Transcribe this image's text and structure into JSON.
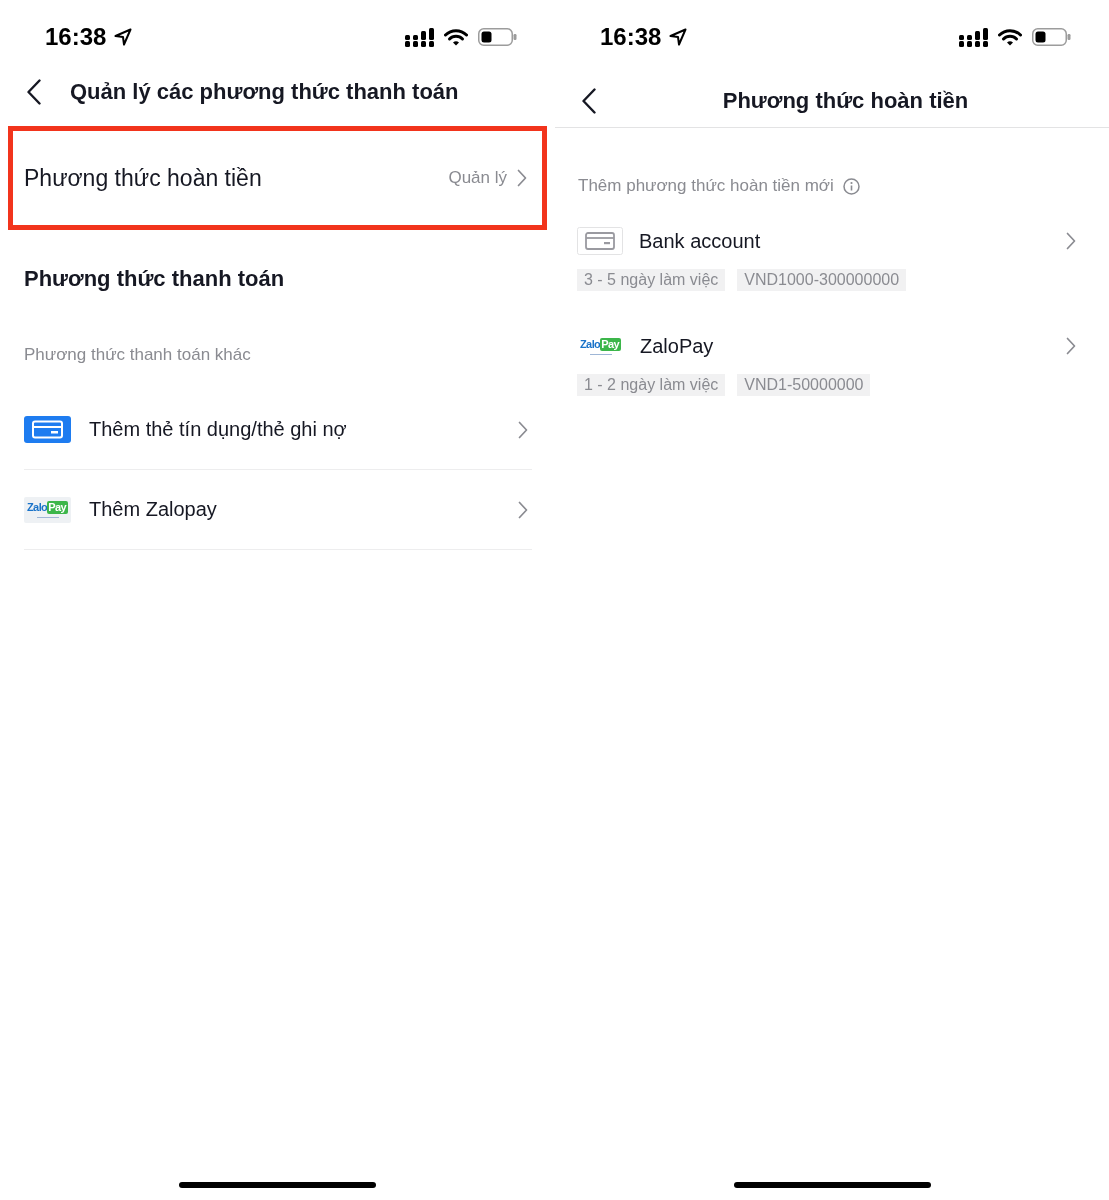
{
  "manage_screen": {
    "status_bar": {
      "time": "16:38"
    },
    "header": {
      "title": "Quản lý các phương thức thanh toán"
    },
    "refund_row": {
      "label": "Phương thức hoàn tiền",
      "action": "Quản lý",
      "highlighted": true
    },
    "payment_section": {
      "title": "Phương thức thanh toán",
      "subtitle": "Phương thức thanh toán khác",
      "items": [
        {
          "kind": "card",
          "label": "Thêm thẻ tín dụng/thẻ ghi nợ"
        },
        {
          "kind": "zalopay",
          "logo": [
            "Zalo",
            "Pay"
          ],
          "label": "Thêm Zalopay"
        }
      ]
    }
  },
  "refund_screen": {
    "status_bar": {
      "time": "16:38"
    },
    "header": {
      "title": "Phương thức hoàn tiền"
    },
    "section_label": "Thêm phương thức hoàn tiền mới",
    "methods": [
      {
        "kind": "bank",
        "name": "Bank account",
        "tags": [
          "3 - 5 ngày làm việc",
          "VND1000-300000000"
        ]
      },
      {
        "kind": "zalopay",
        "logo": [
          "Zalo",
          "Pay"
        ],
        "name": "ZaloPay",
        "tags": [
          "1 - 2 ngày làm việc",
          "VND1-50000000"
        ]
      }
    ]
  }
}
